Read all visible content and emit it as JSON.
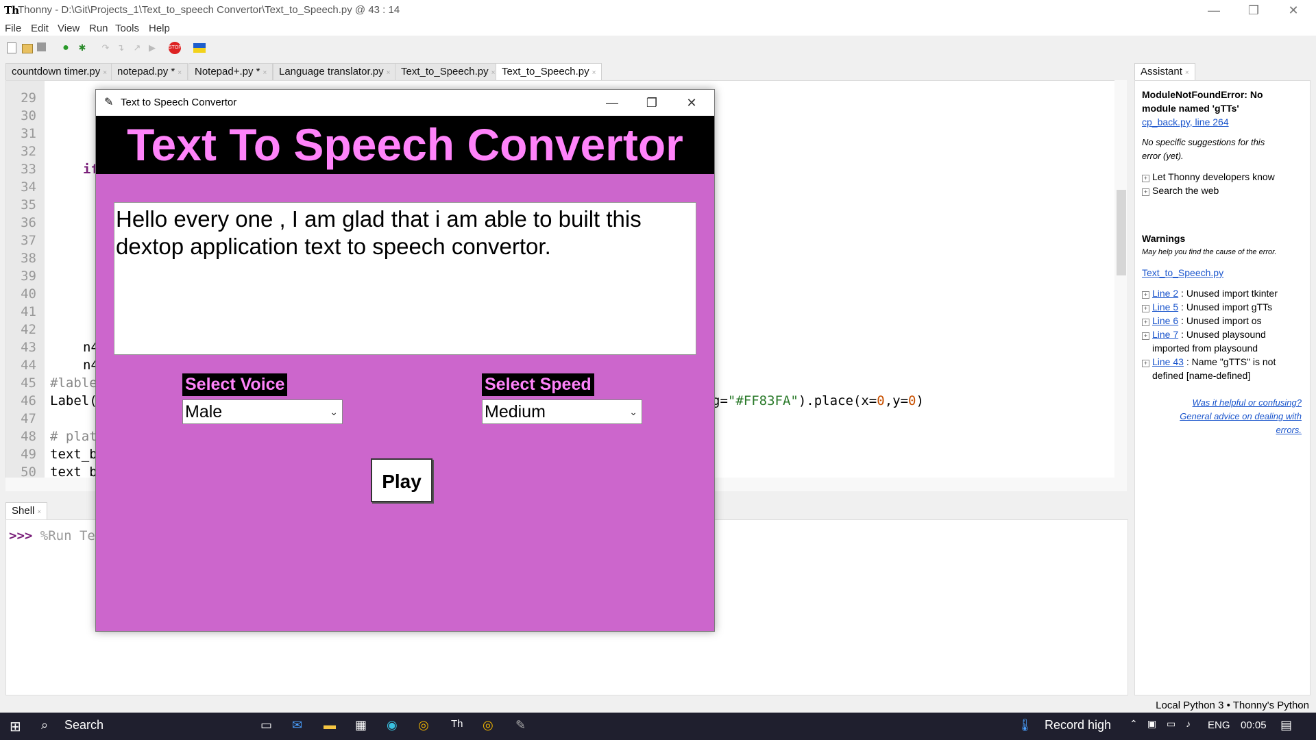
{
  "window": {
    "logo": "Th",
    "title": "Thonny  -  D:\\Git\\Projects_1\\Text_to_speech Convertor\\Text_to_Speech.py  @  43 : 14",
    "minimize": "—",
    "maximize": "❐",
    "close": "✕"
  },
  "menu": [
    "File",
    "Edit",
    "View",
    "Run",
    "Tools",
    "Help"
  ],
  "tabs": [
    {
      "label": "countdown timer.py",
      "close": "×"
    },
    {
      "label": "notepad.py *",
      "close": "×"
    },
    {
      "label": "Notepad+.py *",
      "close": "×"
    },
    {
      "label": "Language translator.py",
      "close": "×"
    },
    {
      "label": "Text_to_Speech.py",
      "close": "×"
    },
    {
      "label": "Text_to_Speech.py",
      "close": "×"
    }
  ],
  "gutter": [
    "29",
    "30",
    "31",
    "32",
    "33",
    "34",
    "35",
    "36",
    "37",
    "38",
    "39",
    "40",
    "41",
    "42",
    "43",
    "44",
    "45",
    "46",
    "47",
    "48",
    "49",
    "50"
  ],
  "code": {
    "l33": "if",
    "l43": "n4",
    "l44": "n4",
    "l45": "#lable",
    "l46": "Label(",
    "l46b_pre": "g=",
    "l46b_str": "\"#FF83FA\"",
    "l46b_mid": ").place(x=",
    "l46b_n1": "0",
    "l46b_sep": ",y=",
    "l46b_n2": "0",
    "l46b_end": ")",
    "l48": "# plat",
    "l49": "text_b",
    "l50": "text_b"
  },
  "shell": {
    "tab": "Shell",
    "close": "×",
    "prompt": ">>>",
    "cmd": " %Run Te"
  },
  "assistant": {
    "tab": "Assistant",
    "close": "×",
    "error_title1": "ModuleNotFoundError: No",
    "error_title2": "module named 'gTTs'",
    "error_link": "cp_back.py, line 264",
    "no_sugg1": "No specific suggestions for this",
    "no_sugg2": "error (yet).",
    "opt1": "Let Thonny developers know",
    "opt2": "Search the web",
    "warnings": "Warnings",
    "warnings_sub": "May help you find the cause of the error.",
    "file_link": "Text_to_Speech.py",
    "w1_link": "Line 2",
    "w1": " : Unused import tkinter",
    "w2_link": "Line 5",
    "w2": " : Unused import gTTs",
    "w3_link": "Line 6",
    "w3": " : Unused import os",
    "w4_link": "Line 7",
    "w4": " : Unused playsound",
    "w4b": "imported from playsound",
    "w5_link": "Line 43",
    "w5": " : Name \"gTTS\" is not",
    "w5b": "defined  [name-defined]",
    "help1": "Was it helpful or confusing?",
    "help2": "General advice on dealing with",
    "help3": "errors."
  },
  "status": "Local Python 3  •  Thonny's Python",
  "taskbar": {
    "search": "Search",
    "record": "Record high",
    "lang": "ENG",
    "time": "00:05"
  },
  "dialog": {
    "title": "Text  to Speech Convertor",
    "header": "Text To Speech Convertor",
    "text": "Hello every one , I am glad that i am able to built this dextop application text to speech convertor.",
    "voice_label": "Select Voice",
    "voice_value": "Male",
    "speed_label": "Select Speed",
    "speed_value": "Medium",
    "play": "Play",
    "header_color": "#FF83FA",
    "bg_color": "#CC66CC"
  }
}
